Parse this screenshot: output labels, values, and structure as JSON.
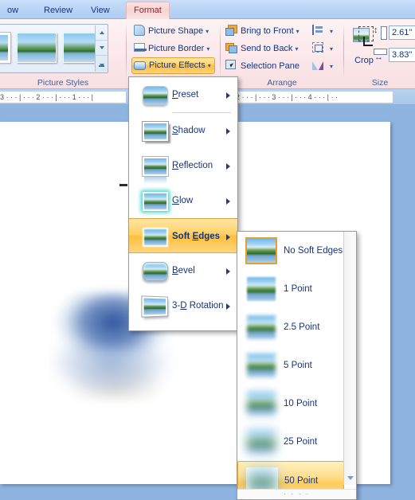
{
  "ribbon": {
    "tabs": [
      {
        "label": "ow",
        "active": false
      },
      {
        "label": "Review",
        "active": false
      },
      {
        "label": "View",
        "active": false
      },
      {
        "label": "Format",
        "active": true
      }
    ],
    "groups": {
      "picture_styles": {
        "label": "Picture Styles",
        "scroll_up": "scroll-up-icon",
        "scroll_down": "scroll-down-icon",
        "more": "more-styles-icon"
      },
      "picture_tools": {
        "picture_shape": "Picture Shape",
        "picture_border": "Picture Border",
        "picture_effects": "Picture Effects",
        "dropdown_caret": "▾"
      },
      "arrange": {
        "label": "Arrange",
        "bring_to_front": "Bring to Front",
        "send_to_back": "Send to Back",
        "selection_pane": "Selection Pane",
        "align": "align-icon",
        "group": "group-icon",
        "rotate": "rotate-icon"
      },
      "size": {
        "label": "Size",
        "crop": "Crop",
        "height_value": "2.61\"",
        "width_value": "3.83\""
      }
    }
  },
  "ruler": {
    "left_marks": "3 · · · | · · · 2 · · · | · · · 1 · · · |",
    "right_marks": "2 · · · | · · · 3 · · · | · · · 4 · · · | · ·"
  },
  "menu": {
    "name": "Picture Effects menu",
    "items": [
      {
        "label": "Preset",
        "accel": "P",
        "preview": "preset",
        "selected": false,
        "has_submenu": true
      },
      {
        "label": "Shadow",
        "accel": "S",
        "preview": "shadow",
        "selected": false,
        "has_submenu": true
      },
      {
        "label": "Reflection",
        "accel": "R",
        "preview": "reflection",
        "selected": false,
        "has_submenu": true
      },
      {
        "label": "Glow",
        "accel": "G",
        "preview": "glow",
        "selected": false,
        "has_submenu": true
      },
      {
        "label": "Soft Edges",
        "accel": "E",
        "preview": "soft-edges",
        "selected": true,
        "has_submenu": true
      },
      {
        "label": "Bevel",
        "accel": "B",
        "preview": "bevel",
        "selected": false,
        "has_submenu": true
      },
      {
        "label": "3-D Rotation",
        "accel": "D",
        "preview": "3d-rotation",
        "selected": false,
        "has_submenu": true
      }
    ]
  },
  "submenu": {
    "name": "Soft Edges variations",
    "items": [
      {
        "label": "No Soft Edges",
        "selected_thumb": true,
        "highlighted": false
      },
      {
        "label": "1 Point",
        "selected_thumb": false,
        "highlighted": false
      },
      {
        "label": "2.5 Point",
        "selected_thumb": false,
        "highlighted": false
      },
      {
        "label": "5 Point",
        "selected_thumb": false,
        "highlighted": false
      },
      {
        "label": "10 Point",
        "selected_thumb": false,
        "highlighted": false
      },
      {
        "label": "25 Point",
        "selected_thumb": false,
        "highlighted": false
      },
      {
        "label": "50 Point",
        "selected_thumb": false,
        "highlighted": true
      }
    ],
    "scroll_down": "scroll-down-icon",
    "grip": "· · · ·"
  },
  "colors": {
    "accent_orange": "#ffbf3c",
    "tab_active": "#f7d4d6",
    "ribbon_bg": "#fbe8ea",
    "menu_text": "#15357a",
    "canvas_bg": "#8fb4e0"
  }
}
